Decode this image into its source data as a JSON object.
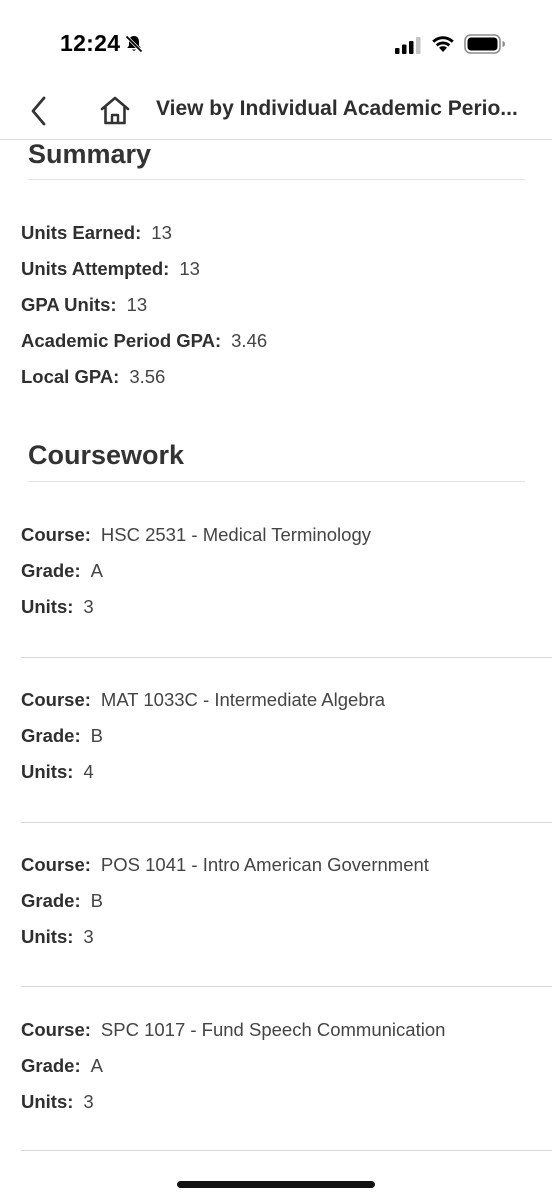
{
  "status_bar": {
    "time": "12:24"
  },
  "nav": {
    "title": "View by Individual Academic Perio..."
  },
  "summary": {
    "heading": "Summary",
    "fields": [
      {
        "label": "Units Earned:",
        "value": "13"
      },
      {
        "label": "Units Attempted:",
        "value": "13"
      },
      {
        "label": "GPA Units:",
        "value": "13"
      },
      {
        "label": "Academic Period GPA:",
        "value": "3.46"
      },
      {
        "label": "Local GPA:",
        "value": "3.56"
      }
    ]
  },
  "coursework": {
    "heading": "Coursework",
    "courses": [
      {
        "course_label": "Course:",
        "course": "HSC 2531 - Medical Terminology",
        "grade_label": "Grade:",
        "grade": "A",
        "units_label": "Units:",
        "units": "3"
      },
      {
        "course_label": "Course:",
        "course": "MAT 1033C - Intermediate Algebra",
        "grade_label": "Grade:",
        "grade": "B",
        "units_label": "Units:",
        "units": "4"
      },
      {
        "course_label": "Course:",
        "course": "POS 1041 - Intro American Government",
        "grade_label": "Grade:",
        "grade": "B",
        "units_label": "Units:",
        "units": "3"
      },
      {
        "course_label": "Course:",
        "course": "SPC 1017 - Fund Speech Communication",
        "grade_label": "Grade:",
        "grade": "A",
        "units_label": "Units:",
        "units": "3"
      }
    ]
  },
  "icons": {
    "back": "chevron-left-icon",
    "home": "home-icon",
    "silent": "bell-slash-icon",
    "signal": "cellular-signal-icon",
    "wifi": "wifi-icon",
    "battery": "battery-icon"
  }
}
